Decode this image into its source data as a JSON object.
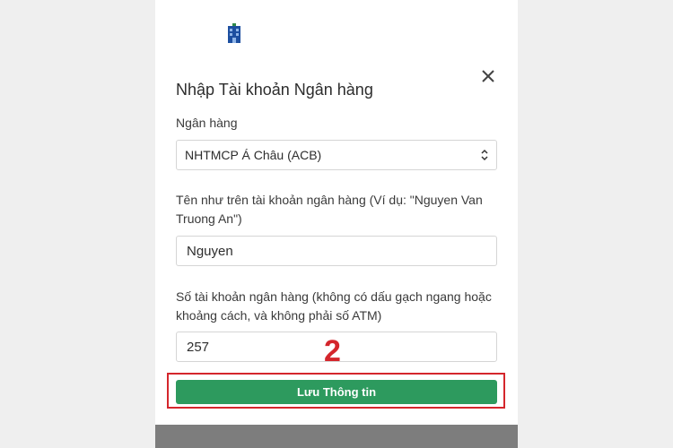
{
  "modal": {
    "title": "Nhập Tài khoản Ngân hàng",
    "close_icon": "close-icon"
  },
  "bank_field": {
    "label": "Ngân hàng",
    "selected": "NHTMCP Á Châu (ACB)"
  },
  "name_field": {
    "label": "Tên như trên tài khoản ngân hàng (Ví dụ: \"Nguyen Van Truong An\")",
    "value": "Nguyen"
  },
  "account_field": {
    "label": "Số tài khoản ngân hàng (không có dấu gạch ngang hoặc khoảng cách, và không phải số ATM)",
    "value": "257"
  },
  "annotation": {
    "step": "2",
    "color": "#d4262c"
  },
  "save_button": {
    "label": "Lưu Thông tin",
    "color": "#2d9a5e"
  }
}
